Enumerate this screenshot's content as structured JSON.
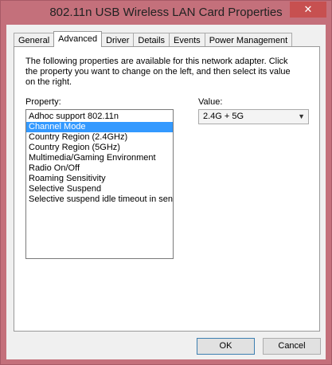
{
  "window": {
    "title": "802.11n USB Wireless LAN Card Properties",
    "close_glyph": "✕"
  },
  "tabs": [
    {
      "label": "General",
      "active": false
    },
    {
      "label": "Advanced",
      "active": true
    },
    {
      "label": "Driver",
      "active": false
    },
    {
      "label": "Details",
      "active": false
    },
    {
      "label": "Events",
      "active": false
    },
    {
      "label": "Power Management",
      "active": false
    }
  ],
  "advanced": {
    "description": "The following properties are available for this network adapter. Click the property you want to change on the left, and then select its value on the right.",
    "property_label": "Property:",
    "value_label": "Value:",
    "properties": [
      "Adhoc support 802.11n",
      "Channel Mode",
      "Country Region (2.4GHz)",
      "Country Region (5GHz)",
      "Multimedia/Gaming Environment",
      "Radio On/Off",
      "Roaming Sensitivity",
      "Selective Suspend",
      "Selective suspend idle timeout in seno"
    ],
    "selected_index": 1,
    "value": "2.4G + 5G"
  },
  "buttons": {
    "ok": "OK",
    "cancel": "Cancel"
  },
  "colors": {
    "frame": "#c4707b",
    "selection": "#3399ff"
  }
}
